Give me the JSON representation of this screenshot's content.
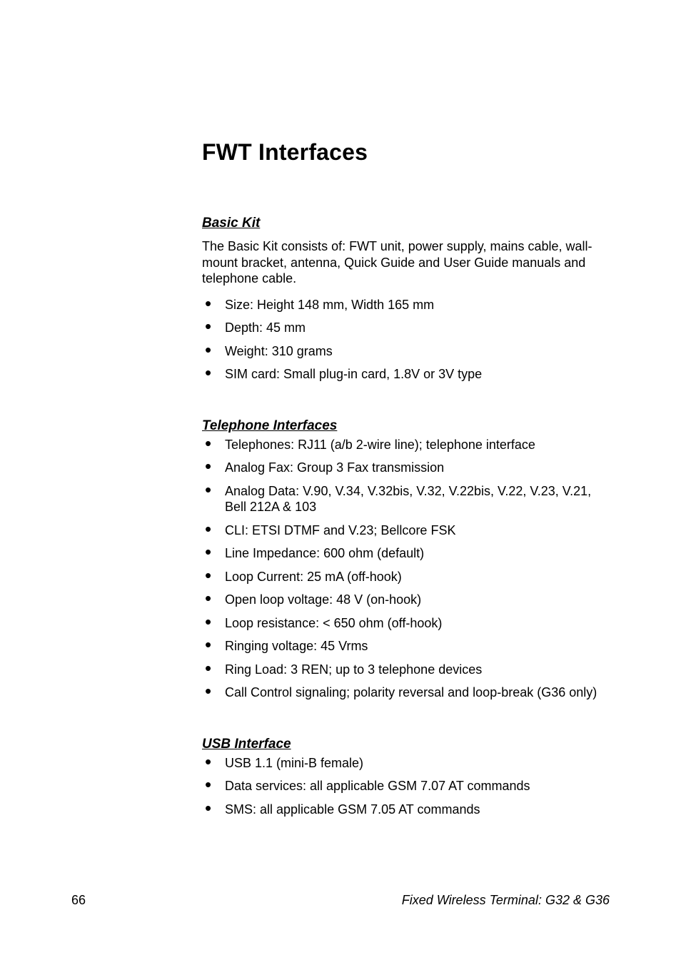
{
  "title": "FWT Interfaces",
  "sections": {
    "basic_kit": {
      "heading": "Basic Kit",
      "intro": "The Basic Kit consists of: FWT unit, power supply, mains cable, wall-mount bracket, antenna, Quick Guide and User Guide manuals and telephone cable.",
      "items": [
        "Size: Height 148 mm, Width 165 mm",
        "Depth: 45 mm",
        "Weight: 310 grams",
        "SIM card: Small plug-in card, 1.8V or 3V type"
      ]
    },
    "telephone_interfaces": {
      "heading": "Telephone Interfaces",
      "items": [
        "Telephones: RJ11 (a/b 2-wire line); telephone interface",
        "Analog Fax: Group 3 Fax transmission",
        "Analog Data: V.90, V.34, V.32bis, V.32, V.22bis, V.22, V.23, V.21, Bell 212A & 103",
        "CLI: ETSI DTMF and V.23; Bellcore FSK",
        "Line Impedance: 600 ohm (default)",
        "Loop Current: 25 mA (off-hook)",
        "Open loop voltage: 48 V (on-hook)",
        "Loop resistance: < 650 ohm (off-hook)",
        "Ringing voltage: 45 Vrms",
        "Ring Load: 3 REN; up to 3 telephone devices",
        "Call Control signaling; polarity reversal and loop-break (G36 only)"
      ]
    },
    "usb_interface": {
      "heading": "USB Interface",
      "items": [
        "USB 1.1 (mini-B female)",
        "Data services: all applicable GSM 7.07 AT commands",
        "SMS: all applicable GSM 7.05 AT commands"
      ]
    }
  },
  "footer": {
    "page_number": "66",
    "doc_title": "Fixed Wireless Terminal: G32 & G36"
  }
}
